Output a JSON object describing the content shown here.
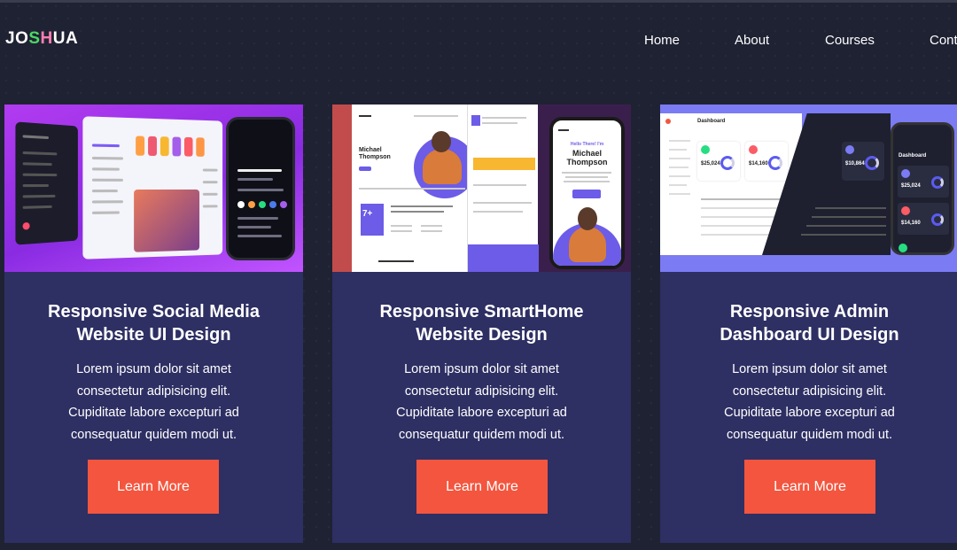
{
  "header": {
    "logo": {
      "part1": "JO",
      "part2": "S",
      "part3": "H",
      "part4": "UA"
    },
    "nav": [
      "Home",
      "About",
      "Courses",
      "Cont"
    ]
  },
  "cards": [
    {
      "image_alt": "social media UI mockup",
      "title_line1": "Responsive Social Media",
      "title_line2": "Website UI Design",
      "desc_lines": [
        "Lorem ipsum dolor sit amet",
        "consectetur adipisicing elit.",
        "Cupiditate labore excepturi ad",
        "consequatur quidem modi ut."
      ],
      "button": "Learn More"
    },
    {
      "image_alt": "smarthome website mockup",
      "title_line1": "Responsive SmartHome",
      "title_line2": "Website Design",
      "desc_lines": [
        "Lorem ipsum dolor sit amet",
        "consectetur adipisicing elit.",
        "Cupiditate labore excepturi ad",
        "consequatur quidem modi ut."
      ],
      "button": "Learn More",
      "mockup": {
        "hero_name_1": "Michael",
        "hero_name_2": "Thompson",
        "phone_greeting": "Hello There! I'm",
        "stat": "7+"
      }
    },
    {
      "image_alt": "admin dashboard mockup",
      "title_line1": "Responsive Admin",
      "title_line2": "Dashboard UI Design",
      "desc_lines": [
        "Lorem ipsum dolor sit amet",
        "consectetur adipisicing elit.",
        "Cupiditate labore excepturi ad",
        "consequatur quidem modi ut."
      ],
      "button": "Learn More",
      "mockup": {
        "heading": "Dashboard",
        "v1": "$25,024",
        "v2": "$14,160",
        "v3": "$10,864"
      }
    }
  ],
  "colors": {
    "background": "#1f2233",
    "card": "#2e2f63",
    "button": "#f4553e",
    "logo_green": "#4cd964",
    "logo_pink": "#ff7fb2"
  }
}
